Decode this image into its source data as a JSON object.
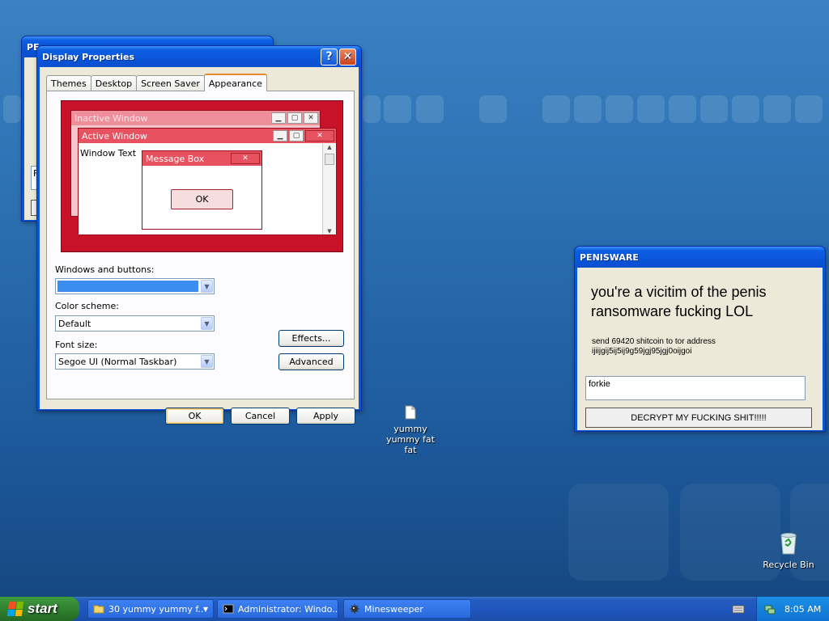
{
  "back_window": {
    "title": "PE",
    "label_f": "F"
  },
  "display_properties": {
    "title": "Display Properties",
    "tabs": [
      "Themes",
      "Desktop",
      "Screen Saver",
      "Appearance"
    ],
    "active_tab": "Appearance",
    "preview": {
      "inactive_title": "Inactive Window",
      "active_title": "Active Window",
      "window_text": "Window Text",
      "message_title": "Message Box",
      "ok_label": "OK"
    },
    "windows_buttons_label": "Windows and buttons:",
    "windows_buttons_value": "",
    "color_scheme_label": "Color scheme:",
    "color_scheme_value": "Default",
    "font_size_label": "Font size:",
    "font_size_value": "Segoe UI (Normal Taskbar)",
    "effects_label": "Effects...",
    "advanced_label": "Advanced",
    "ok_label": "OK",
    "cancel_label": "Cancel",
    "apply_label": "Apply"
  },
  "ransom_window": {
    "title": "PENISWARE",
    "heading": "you're a vicitim of the penis ransomware fucking LOL",
    "line1": "send 69420 shitcoin to tor address",
    "line2": "ijiijgij5ij5ij9g59jgj95jgj0oijgoi",
    "input_value": "forkie",
    "decrypt_label": "DECRYPT MY FUCKING SHIT!!!!!"
  },
  "desktop": {
    "file_icon_label": "yummy yummy fat fat",
    "recycle_bin_label": "Recycle Bin"
  },
  "taskbar": {
    "start_label": "start",
    "tasks": [
      "30 yummy yummy f...",
      "Administrator: Windo...",
      "Minesweeper"
    ],
    "clock": "8:05 AM"
  },
  "colors": {
    "desktop": "#2b6fb0",
    "titlebar": "#0a55d8",
    "preview_bg": "#c8122a",
    "swatch": "#3c8df0"
  }
}
